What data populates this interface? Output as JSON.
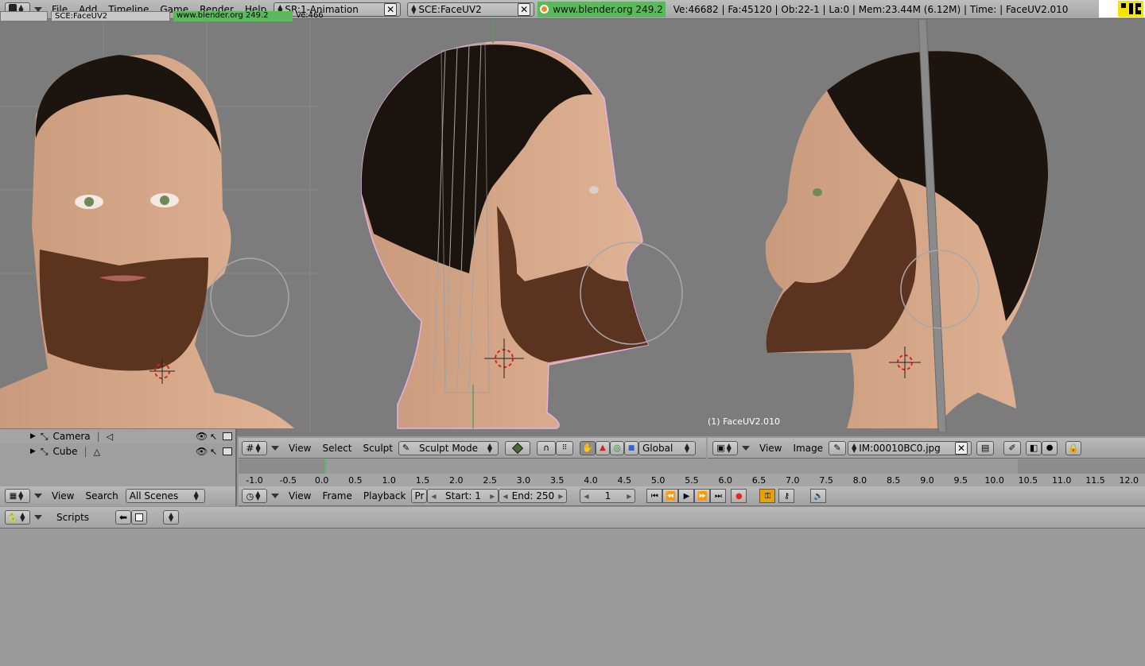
{
  "top_menu": {
    "items": [
      "File",
      "Add",
      "Timeline",
      "Game",
      "Render",
      "Help"
    ],
    "screen_field": "SR:1-Animation",
    "scene_field": "SCE:FaceUV2",
    "website": "www.blender.org 249.2",
    "stats": "Ve:46682 | Fa:45120 | Ob:22-1 | La:0 | Mem:23.44M (6.12M) | Time: | FaceUV2.010"
  },
  "outliner_tabs": {
    "scene_tab": "SCE:FaceUV2",
    "web_tab": "www.blender.org 249.2",
    "stats_tab": "Ve:466"
  },
  "outliner": {
    "items": [
      {
        "label": "Camera",
        "type_icon": "camera-icon"
      },
      {
        "label": "Cube",
        "type_icon": "mesh-icon"
      }
    ],
    "header": {
      "view": "View",
      "search": "Search",
      "scene_filter": "All Scenes"
    }
  },
  "viewport": {
    "object_label": "(1) FaceUV2.010",
    "header": {
      "view": "View",
      "select": "Select",
      "sculpt": "Sculpt",
      "mode": "Sculpt Mode",
      "orientation": "Global"
    }
  },
  "image_editor": {
    "header": {
      "view": "View",
      "image": "Image",
      "image_name": "IM:00010BC0.jpg"
    }
  },
  "timeline": {
    "ticks": [
      "-1.0",
      "-0.5",
      "0.0",
      "0.5",
      "1.0",
      "1.5",
      "2.0",
      "2.5",
      "3.0",
      "3.5",
      "4.0",
      "4.5",
      "5.0",
      "5.5",
      "6.0",
      "6.5",
      "7.0",
      "7.5",
      "8.0",
      "8.5",
      "9.0",
      "9.5",
      "10.0",
      "10.5",
      "11.0",
      "11.5",
      "12.0"
    ],
    "header": {
      "view": "View",
      "frame": "Frame",
      "playback": "Playback",
      "pr": "Pr",
      "start": "Start: 1",
      "end": "End: 250",
      "current": "1"
    }
  },
  "scripts": {
    "label": "Scripts"
  },
  "colors": {
    "accent_green": "#5cb85c",
    "header_gray": "#a8a8a8",
    "viewport_gray": "#7c7c7c",
    "bg": "#999999"
  }
}
